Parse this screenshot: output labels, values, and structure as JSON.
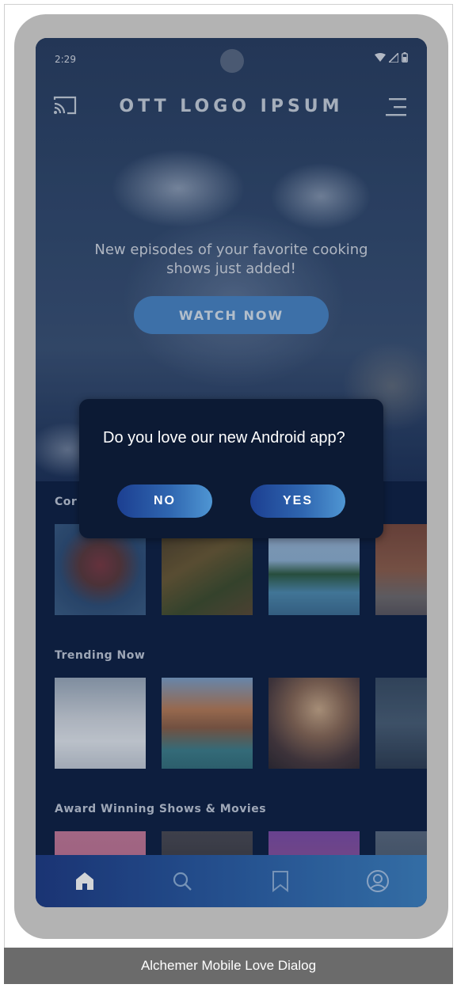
{
  "status_bar": {
    "time": "2:29"
  },
  "app": {
    "logo": "OTT LOGO IPSUM"
  },
  "hero": {
    "headline": "New episodes of your favorite cooking shows just added!",
    "cta_label": "WATCH NOW"
  },
  "sections": [
    {
      "title": "Continue Watching",
      "visible_title": "Cor"
    },
    {
      "title": "Trending Now"
    },
    {
      "title": "Award Winning Shows & Movies"
    }
  ],
  "dialog": {
    "question": "Do you love our new Android app?",
    "no_label": "NO",
    "yes_label": "YES"
  },
  "nav": {
    "items": [
      {
        "icon": "home-icon",
        "active": true
      },
      {
        "icon": "search-icon",
        "active": false
      },
      {
        "icon": "bookmark-icon",
        "active": false
      },
      {
        "icon": "profile-icon",
        "active": false
      }
    ]
  },
  "caption": "Alchemer Mobile Love Dialog",
  "colors": {
    "accent": "#3e82c2",
    "dialog_bg": "#0c1a34",
    "app_bg": "#0f2145"
  }
}
